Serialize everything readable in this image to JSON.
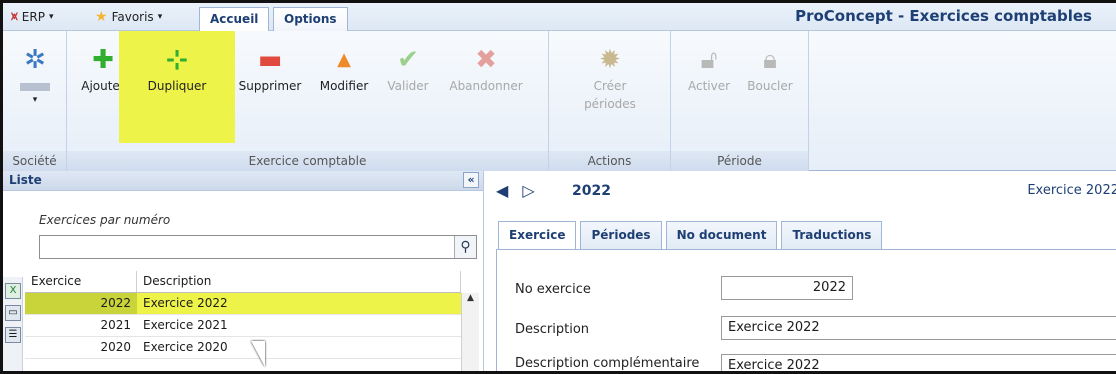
{
  "topbar": {
    "erp_label": "ERP",
    "favoris_label": "Favoris",
    "tabs": [
      {
        "label": "Accueil"
      },
      {
        "label": "Options"
      }
    ],
    "app_title": "ProConcept - Exercices comptables"
  },
  "ribbon": {
    "groups": [
      {
        "label": "Société"
      },
      {
        "label": "Exercice comptable"
      },
      {
        "label": "Actions"
      },
      {
        "label": "Période"
      }
    ],
    "buttons": {
      "ajouter": "Ajouter",
      "dupliquer": "Dupliquer",
      "supprimer": "Supprimer",
      "modifier": "Modifier",
      "valider": "Valider",
      "abandonner": "Abandonner",
      "creer_1": "Créer",
      "creer_2": "périodes",
      "activer": "Activer",
      "boucler": "Boucler"
    }
  },
  "left": {
    "title": "Liste",
    "collapse_symbol": "«",
    "sort_label": "Exercices par numéro",
    "search_value": "",
    "columns": [
      "Exercice",
      "Description"
    ],
    "rows": [
      {
        "exercice": "2022",
        "description": "Exercice 2022"
      },
      {
        "exercice": "2021",
        "description": "Exercice 2021"
      },
      {
        "exercice": "2020",
        "description": "Exercice 2020"
      }
    ]
  },
  "right": {
    "current_year": "2022",
    "header_right": "Exercice 2022",
    "tabs": [
      {
        "label": "Exercice"
      },
      {
        "label": "Périodes"
      },
      {
        "label": "No document"
      },
      {
        "label": "Traductions"
      }
    ],
    "form": {
      "no_exercice_label": "No exercice",
      "no_exercice_value": "2022",
      "description_label": "Description",
      "description_value": "Exercice 2022",
      "desc_comp_label": "Description complémentaire",
      "desc_comp_value": "Exercice 2022"
    }
  },
  "colors": {
    "highlight": "#eef34a",
    "accent": "#1e3f74",
    "add_green": "#2fae2f",
    "remove_red": "#e04a3f"
  }
}
